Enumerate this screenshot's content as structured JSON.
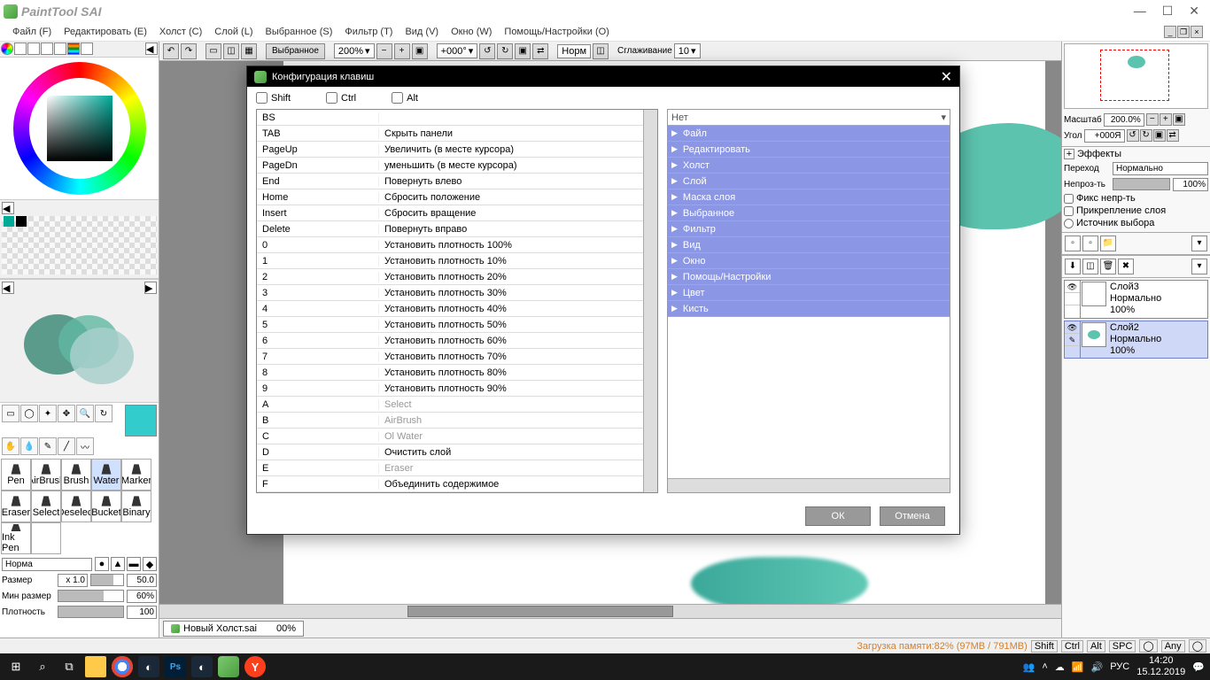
{
  "app": {
    "name": "PaintTool SAI"
  },
  "win": {
    "min": "—",
    "max": "☐",
    "close": "✕"
  },
  "menu": [
    "Файл (F)",
    "Редактировать (E)",
    "Холст (C)",
    "Слой (L)",
    "Выбранное (S)",
    "Фильтр (T)",
    "Вид (V)",
    "Окно (W)",
    "Помощь/Настройки (O)"
  ],
  "toolbar": {
    "sel_label": "Выбранное",
    "zoom": "200%",
    "angle": "+000°",
    "mode": "Норм",
    "smooth_label": "Сглаживание",
    "smooth": "10"
  },
  "brushes": [
    "Pen",
    "AirBrush",
    "Brush",
    "Water",
    "Marker",
    "Eraser",
    "Select",
    "Deselect",
    "Bucket",
    "Binary",
    "Ink Pen",
    ""
  ],
  "bprops": {
    "blend": "Норма",
    "size_label": "Размер",
    "size_mult": "x 1.0",
    "size": "50.0",
    "minsize_label": "Мин размер",
    "minsize": "60%",
    "density_label": "Плотность",
    "density": "100"
  },
  "doc": {
    "tab": "Новый Холст.sai",
    "pct": "00%"
  },
  "nav": {
    "scale_label": "Масштаб",
    "scale": "200.0%",
    "angle_label": "Угол",
    "angle": "+000Я"
  },
  "effects": {
    "title": "Эффекты",
    "blend_label": "Переход",
    "blend": "Нормально",
    "opacity_label": "Непроз-ть",
    "opacity": "100%",
    "fix": "Фикс непр-ть",
    "clip": "Прикрепление слоя",
    "src": "Источник выбора"
  },
  "layers": [
    {
      "name": "Слой3",
      "mode": "Нормально",
      "op": "100%",
      "sel": false
    },
    {
      "name": "Слой2",
      "mode": "Нормально",
      "op": "100%",
      "sel": true
    }
  ],
  "dlg": {
    "title": "Конфигурация клавиш",
    "mods": [
      "Shift",
      "Ctrl",
      "Alt"
    ],
    "keys": [
      {
        "k": "BS",
        "a": ""
      },
      {
        "k": "TAB",
        "a": "Скрыть панели"
      },
      {
        "k": "PageUp",
        "a": "Увеличить (в месте курсора)"
      },
      {
        "k": "PageDn",
        "a": "уменьшить (в месте курсора)"
      },
      {
        "k": "End",
        "a": "Повернуть влево"
      },
      {
        "k": "Home",
        "a": "Сбросить положение"
      },
      {
        "k": "Insert",
        "a": "Сбросить вращение"
      },
      {
        "k": "Delete",
        "a": "Повернуть вправо"
      },
      {
        "k": "0",
        "a": "Установить плотность 100%"
      },
      {
        "k": "1",
        "a": "Установить плотность 10%"
      },
      {
        "k": "2",
        "a": "Установить плотность 20%"
      },
      {
        "k": "3",
        "a": "Установить плотность 30%"
      },
      {
        "k": "4",
        "a": "Установить плотность 40%"
      },
      {
        "k": "5",
        "a": "Установить плотность 50%"
      },
      {
        "k": "6",
        "a": "Установить плотность 60%"
      },
      {
        "k": "7",
        "a": "Установить плотность 70%"
      },
      {
        "k": "8",
        "a": "Установить плотность 80%"
      },
      {
        "k": "9",
        "a": "Установить плотность 90%"
      },
      {
        "k": "A",
        "a": "Select",
        "g": true
      },
      {
        "k": "B",
        "a": "AirBrush",
        "g": true
      },
      {
        "k": "C",
        "a": "Ol Water",
        "g": true
      },
      {
        "k": "D",
        "a": "Очистить слой"
      },
      {
        "k": "E",
        "a": "Eraser",
        "g": true
      },
      {
        "k": "F",
        "a": "Объединить содержимое"
      }
    ],
    "cats_none": "Нет",
    "cats": [
      "Файл",
      "Редактировать",
      "Холст",
      "Слой",
      "Маска слоя",
      "Выбранное",
      "Фильтр",
      "Вид",
      "Окно",
      "Помощь/Настройки",
      "Цвет",
      "Кисть"
    ],
    "ok": "ОК",
    "cancel": "Отмена"
  },
  "status": {
    "mem": "Загрузка памяти:82% (97MB / 791MB)",
    "mods": [
      "Shift",
      "Ctrl",
      "Alt",
      "SPC",
      "◯",
      "Any",
      "◯"
    ]
  },
  "tray": {
    "lang": "РУС",
    "time": "14:20",
    "date": "15.12.2019"
  }
}
